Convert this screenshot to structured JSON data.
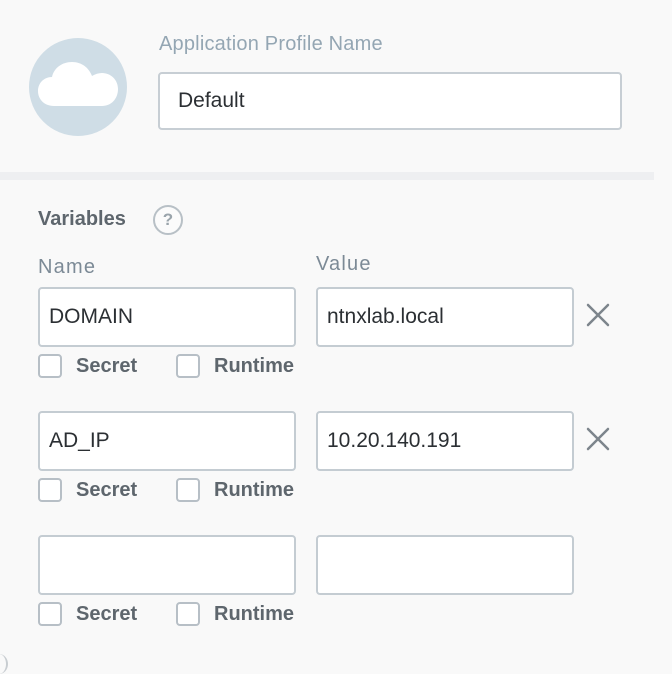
{
  "profile": {
    "label": "Application Profile Name",
    "value": "Default",
    "icon": "cloud-icon"
  },
  "variables": {
    "title": "Variables",
    "help_icon": "?",
    "name_header": "Name",
    "value_header": "Value",
    "secret_label": "Secret",
    "runtime_label": "Runtime",
    "rows": [
      {
        "name": "DOMAIN",
        "value": "ntnxlab.local",
        "secret": false,
        "runtime": false,
        "removable": true
      },
      {
        "name": "AD_IP",
        "value": "10.20.140.191",
        "secret": false,
        "runtime": false,
        "removable": true
      },
      {
        "name": "",
        "value": "",
        "secret": false,
        "runtime": false,
        "removable": false
      }
    ]
  }
}
